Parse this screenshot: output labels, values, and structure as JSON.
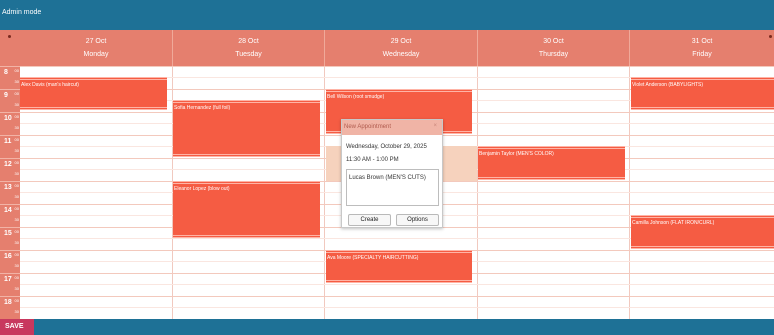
{
  "header": {
    "title": "Admin mode"
  },
  "days": [
    {
      "date": "27 Oct",
      "weekday": "Monday"
    },
    {
      "date": "28 Oct",
      "weekday": "Tuesday"
    },
    {
      "date": "29 Oct",
      "weekday": "Wednesday"
    },
    {
      "date": "30 Oct",
      "weekday": "Thursday"
    },
    {
      "date": "31 Oct",
      "weekday": "Friday"
    }
  ],
  "hours": [
    "8",
    "9",
    "10",
    "11",
    "12",
    "13",
    "14",
    "15",
    "16",
    "17",
    "18"
  ],
  "minute_marks": {
    "top": "00",
    "half": "30"
  },
  "events": [
    {
      "label": "Alex Davis (man's haircut)"
    },
    {
      "label": "Sofia Hernandez (full foil)"
    },
    {
      "label": "Eleanor Lopez (blow out)"
    },
    {
      "label": "Bell Wilson (root smudge)"
    },
    {
      "label": "Ava Moore (SPECIALTY HAIRCUTTING)"
    },
    {
      "label": "Benjamin Taylor (MEN'S COLOR)"
    },
    {
      "label": "Violet Anderson (BABYLIGHTS)"
    },
    {
      "label": "Camilla Johnson (FLAT IRON/CURL)"
    }
  ],
  "popup": {
    "title": "New Appointment",
    "close_glyph": "×",
    "date": "Wednesday, October 29, 2025",
    "time": "11:30 AM - 1:00 PM",
    "client_value": "Lucas Brown (MEN'S CUTS)",
    "create_label": "Create",
    "options_label": "Options"
  },
  "footer": {
    "save_label": "SAVE"
  },
  "colors": {
    "topbar": "#1e7196",
    "header_salmon": "#e57f6e",
    "event": "#f55c43",
    "selection": "#f6d2bd",
    "save": "#c8385e"
  }
}
